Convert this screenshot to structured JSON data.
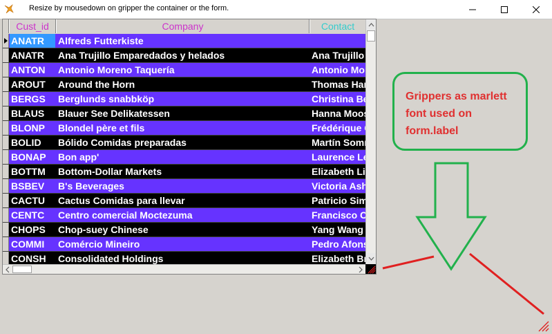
{
  "window": {
    "title": "Resize by mousedown on gripper the container or the form.",
    "icon": "fox-app-icon",
    "controls": [
      "minimize-icon",
      "maximize-icon",
      "close-icon"
    ]
  },
  "grid": {
    "columns": [
      "Cust_id",
      "Company",
      "Contact"
    ],
    "header_colors": {
      "Cust_id": "#cc33cc",
      "Company": "#cc33cc",
      "Contact": "#33cccc"
    },
    "row_colors": [
      "#6633ff",
      "#000000"
    ],
    "current_cell_color": "#3399ff",
    "rows": [
      {
        "cust_id": "ANATR",
        "company": "Alfreds Futterkiste",
        "contact": ""
      },
      {
        "cust_id": "ANATR",
        "company": "Ana Trujillo Emparedados y helados",
        "contact": "Ana Trujillo"
      },
      {
        "cust_id": "ANTON",
        "company": "Antonio Moreno Taquería",
        "contact": "Antonio Moreno"
      },
      {
        "cust_id": "AROUT",
        "company": "Around the Horn",
        "contact": "Thomas Hardy"
      },
      {
        "cust_id": "BERGS",
        "company": "Berglunds snabbköp",
        "contact": "Christina Berglund"
      },
      {
        "cust_id": "BLAUS",
        "company": "Blauer See Delikatessen",
        "contact": "Hanna Moos"
      },
      {
        "cust_id": "BLONP",
        "company": "Blondel père et fils",
        "contact": "Frédérique Citeaux"
      },
      {
        "cust_id": "BOLID",
        "company": "Bólido Comidas preparadas",
        "contact": "Martín Sommer"
      },
      {
        "cust_id": "BONAP",
        "company": "Bon app'",
        "contact": "Laurence Lebihan"
      },
      {
        "cust_id": "BOTTM",
        "company": "Bottom-Dollar Markets",
        "contact": "Elizabeth Lincoln"
      },
      {
        "cust_id": "BSBEV",
        "company": "B's Beverages",
        "contact": "Victoria Ashworth"
      },
      {
        "cust_id": "CACTU",
        "company": "Cactus Comidas para llevar",
        "contact": "Patricio Simpson"
      },
      {
        "cust_id": "CENTC",
        "company": "Centro comercial Moctezuma",
        "contact": "Francisco Chang"
      },
      {
        "cust_id": "CHOPS",
        "company": "Chop-suey Chinese",
        "contact": "Yang Wang"
      },
      {
        "cust_id": "COMMI",
        "company": "Comércio Mineiro",
        "contact": "Pedro Afonso"
      },
      {
        "cust_id": "CONSH",
        "company": "Consolidated Holdings",
        "contact": "Elizabeth Brown"
      }
    ]
  },
  "annotation": {
    "text": "Grippers as marlett font used on form.label",
    "text_color": "#e03030",
    "box_color": "#22b14c",
    "arrow_color": "#22b14c",
    "pointer_color": "#e02020"
  }
}
